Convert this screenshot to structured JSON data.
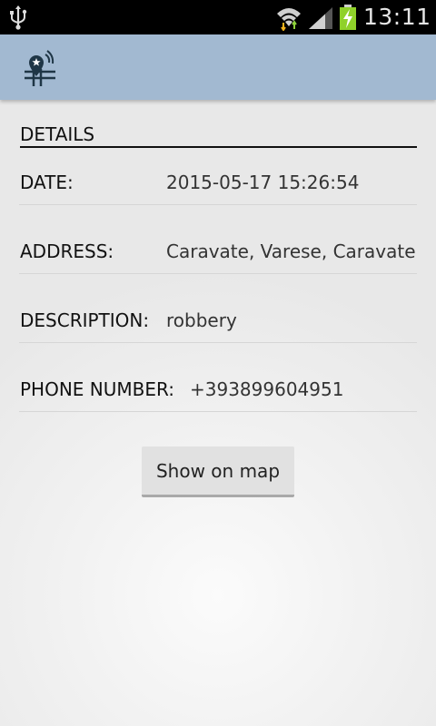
{
  "status_bar": {
    "time": "13:11",
    "icons": [
      "usb-icon",
      "wifi-icon",
      "signal-icon",
      "battery-charging-icon"
    ]
  },
  "action_bar": {
    "app_icon": "app-logo-icon",
    "colors": {
      "background": "#a2b9d1",
      "icon": "#1f3646"
    }
  },
  "details": {
    "title": "DETAILS",
    "rows": [
      {
        "label": "DATE:",
        "value": "2015-05-17 15:26:54"
      },
      {
        "label": "ADDRESS:",
        "value": "Caravate, Varese, Caravate"
      },
      {
        "label": "DESCRIPTION:",
        "value": "robbery"
      },
      {
        "label": "PHONE NUMBER:",
        "value": "+393899604951"
      }
    ]
  },
  "actions": {
    "show_on_map_label": "Show on map"
  }
}
